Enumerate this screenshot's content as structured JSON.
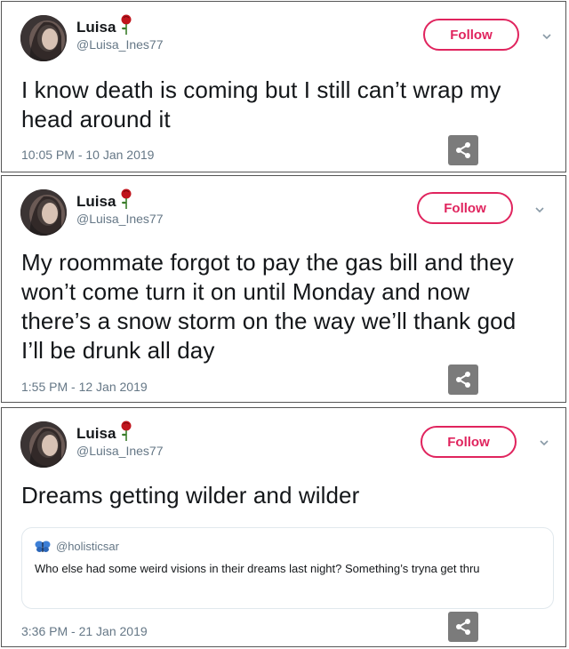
{
  "tweets": [
    {
      "name": "Luisa",
      "handle": "@Luisa_Ines77",
      "follow_label": "Follow",
      "text": "I know death is coming but I still can’t wrap my head around it",
      "timestamp": "10:05 PM - 10 Jan 2019"
    },
    {
      "name": "Luisa",
      "handle": "@Luisa_Ines77",
      "follow_label": "Follow",
      "text": "My roommate forgot to pay the gas bill and they won’t come turn it on until Monday and now there’s a snow storm on the way we’ll thank god I’ll be drunk all day",
      "timestamp": "1:55 PM - 12 Jan 2019"
    },
    {
      "name": "Luisa",
      "handle": "@Luisa_Ines77",
      "follow_label": "Follow",
      "text": "Dreams getting wilder and wilder",
      "timestamp": "3:36 PM - 21 Jan 2019",
      "quote": {
        "handle": "@holisticsar",
        "text": "Who else had some weird visions in their dreams last night? Something’s tryna get thru"
      }
    }
  ],
  "colors": {
    "follow_accent": "#e0245e",
    "secondary_text": "#657786",
    "share_button": "#7b7b7b"
  },
  "icons": {
    "name_emoji": "rose-icon",
    "quote_emoji": "butterfly-icon",
    "share": "share-icon",
    "menu": "chevron-down-icon"
  }
}
